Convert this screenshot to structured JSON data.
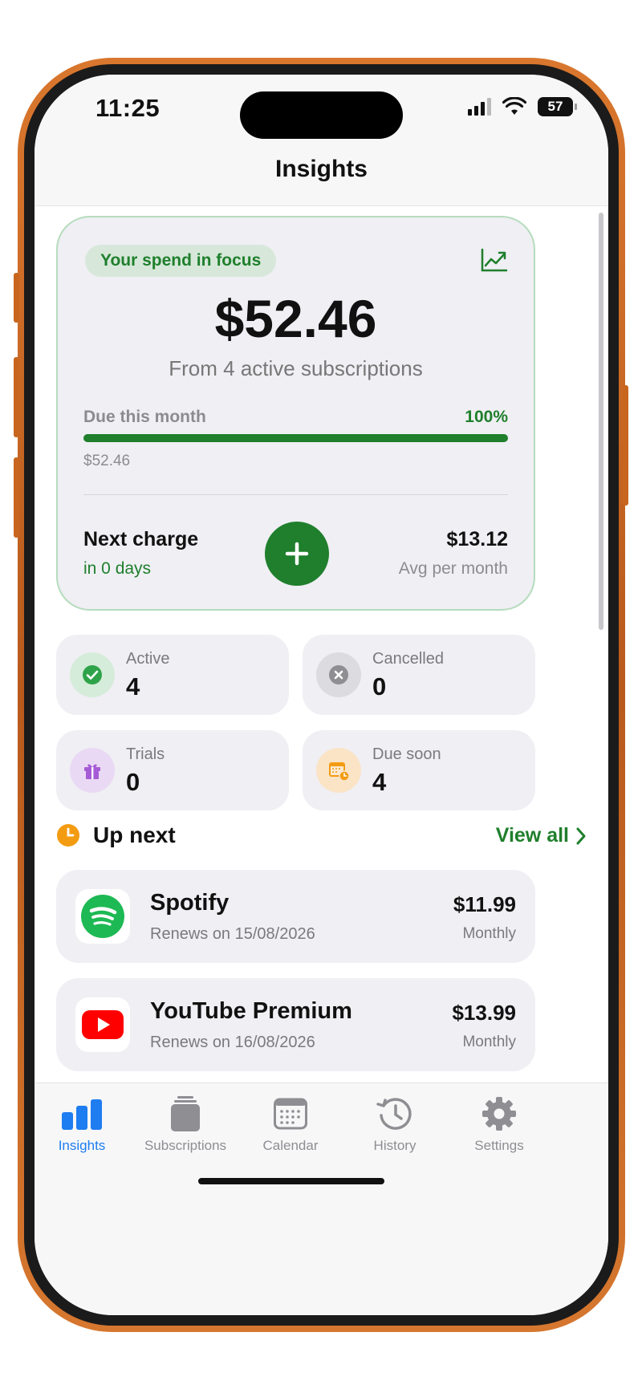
{
  "status_bar": {
    "time": "11:25",
    "battery": "57"
  },
  "nav": {
    "title": "Insights"
  },
  "focus": {
    "badge": "Your spend in focus",
    "amount": "$52.46",
    "subtitle": "From 4 active subscriptions",
    "due_label": "Due this month",
    "due_percent": "100%",
    "due_progress": 1.0,
    "due_amount": "$52.46",
    "next_charge_label": "Next charge",
    "next_charge_days": "in 0 days",
    "avg_amount": "$13.12",
    "avg_label": "Avg per month"
  },
  "stats": [
    {
      "label": "Active",
      "value": "4",
      "icon": "checkmark-icon",
      "color": "#2fa34a"
    },
    {
      "label": "Cancelled",
      "value": "0",
      "icon": "x-circle-icon",
      "color": "#8e8e93"
    },
    {
      "label": "Trials",
      "value": "0",
      "icon": "gift-icon",
      "color": "#a55bd6"
    },
    {
      "label": "Due soon",
      "value": "4",
      "icon": "calendar-clock-icon",
      "color": "#f39c12"
    }
  ],
  "up_next": {
    "title": "Up next",
    "view_all": "View all",
    "items": [
      {
        "name": "Spotify",
        "renews": "Renews on 15/08/2026",
        "price": "$11.99",
        "cycle": "Monthly",
        "icon": "spotify-icon",
        "brand_color": "#1DB954"
      },
      {
        "name": "YouTube Premium",
        "renews": "Renews on 16/08/2026",
        "price": "$13.99",
        "cycle": "Monthly",
        "icon": "youtube-icon",
        "brand_color": "#FF0000"
      }
    ]
  },
  "tabs": [
    {
      "label": "Insights",
      "icon": "bar-chart-icon",
      "active": true
    },
    {
      "label": "Subscriptions",
      "icon": "stack-icon",
      "active": false
    },
    {
      "label": "Calendar",
      "icon": "calendar-icon",
      "active": false
    },
    {
      "label": "History",
      "icon": "history-icon",
      "active": false
    },
    {
      "label": "Settings",
      "icon": "gear-icon",
      "active": false
    }
  ],
  "colors": {
    "accent_green": "#1f7f2c",
    "active_tab_blue": "#1e7df0",
    "card_bg": "#efeff4"
  }
}
